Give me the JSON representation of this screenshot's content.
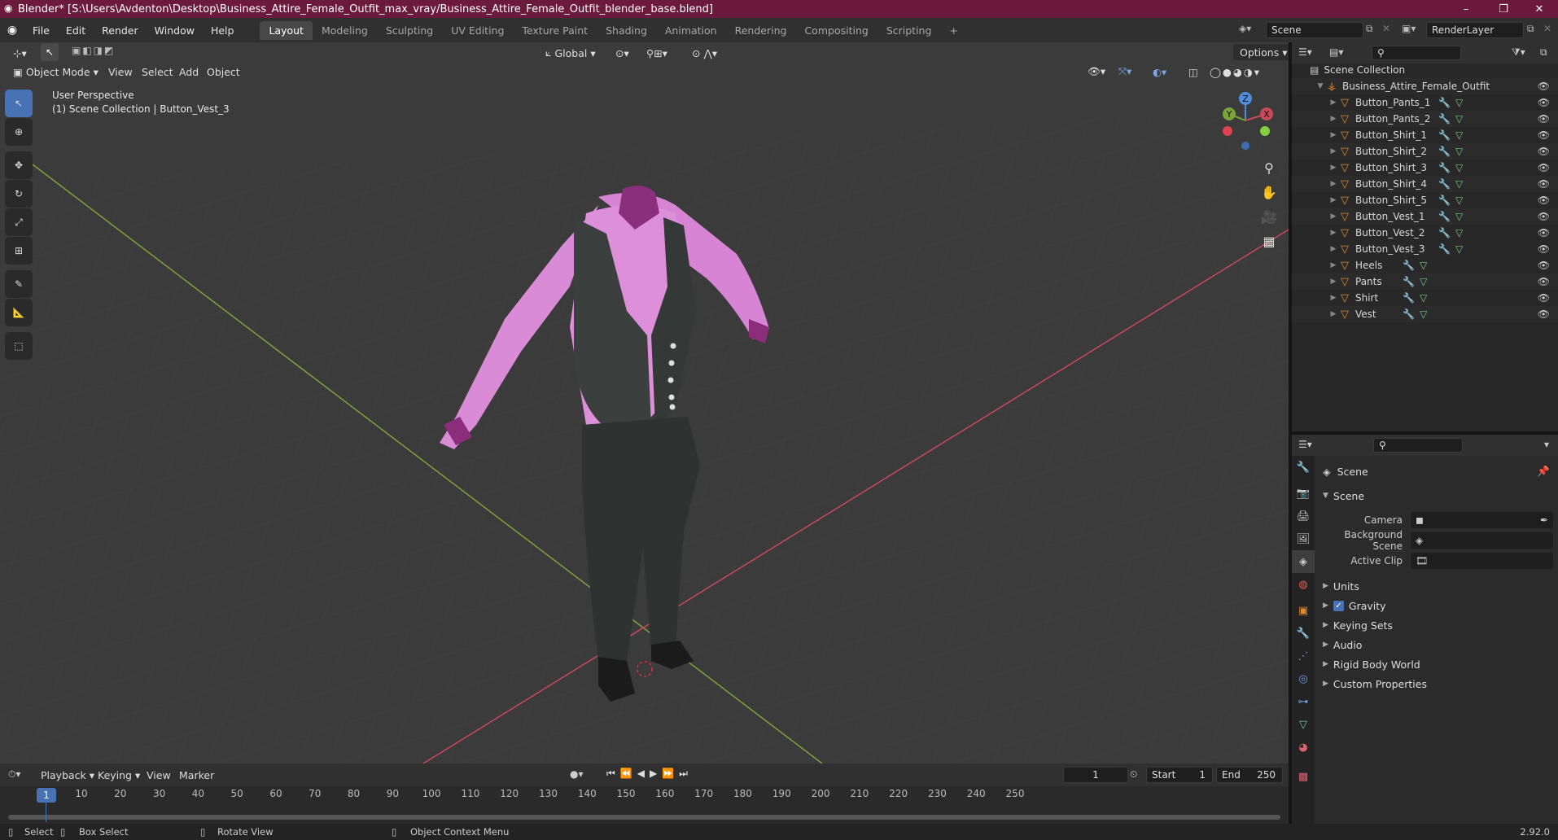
{
  "window": {
    "title": "Blender* [S:\\Users\\Avdenton\\Desktop\\Business_Attire_Female_Outfit_max_vray/Business_Attire_Female_Outfit_blender_base.blend]",
    "minimize": "–",
    "maximize": "❐",
    "close": "✕"
  },
  "menubar": {
    "items": [
      "File",
      "Edit",
      "Render",
      "Window",
      "Help"
    ],
    "workspaces": [
      "Layout",
      "Modeling",
      "Sculpting",
      "UV Editing",
      "Texture Paint",
      "Shading",
      "Animation",
      "Rendering",
      "Compositing",
      "Scripting"
    ],
    "active_workspace": "Layout",
    "add_tab": "+",
    "scene_name": "Scene",
    "render_layer": "RenderLayer"
  },
  "viewport": {
    "mode": "Object Mode",
    "menus": [
      "View",
      "Select",
      "Add",
      "Object"
    ],
    "orientation": "Global",
    "options": "Options",
    "overlay_title": "User Perspective",
    "overlay_sub": "(1) Scene Collection | Button_Vest_3",
    "gizmo": {
      "x": "X",
      "y": "Y",
      "z": "Z"
    }
  },
  "outliner": {
    "root": "Scene Collection",
    "collection": "Business_Attire_Female_Outfit",
    "objects": [
      {
        "name": "Button_Pants_1",
        "selected": false
      },
      {
        "name": "Button_Pants_2",
        "selected": false
      },
      {
        "name": "Button_Shirt_1",
        "selected": false
      },
      {
        "name": "Button_Shirt_2",
        "selected": false
      },
      {
        "name": "Button_Shirt_3",
        "selected": false
      },
      {
        "name": "Button_Shirt_4",
        "selected": false
      },
      {
        "name": "Button_Shirt_5",
        "selected": false
      },
      {
        "name": "Button_Vest_1",
        "selected": false
      },
      {
        "name": "Button_Vest_2",
        "selected": false
      },
      {
        "name": "Button_Vest_3",
        "selected": true
      },
      {
        "name": "Heels",
        "selected": false
      },
      {
        "name": "Pants",
        "selected": false
      },
      {
        "name": "Shirt",
        "selected": false
      },
      {
        "name": "Vest",
        "selected": false
      }
    ]
  },
  "properties": {
    "context": "Scene",
    "panel": "Scene",
    "fields": [
      {
        "label": "Camera",
        "value": ""
      },
      {
        "label": "Background Scene",
        "value": ""
      },
      {
        "label": "Active Clip",
        "value": ""
      }
    ],
    "subpanels": [
      {
        "label": "Units",
        "checkbox": false
      },
      {
        "label": "Gravity",
        "checkbox": true
      },
      {
        "label": "Keying Sets",
        "checkbox": false
      },
      {
        "label": "Audio",
        "checkbox": false
      },
      {
        "label": "Rigid Body World",
        "checkbox": false
      },
      {
        "label": "Custom Properties",
        "checkbox": false
      }
    ]
  },
  "timeline": {
    "menus": [
      "Playback",
      "Keying",
      "View",
      "Marker"
    ],
    "current_frame": "1",
    "start_label": "Start",
    "start": "1",
    "end_label": "End",
    "end": "250",
    "ruler": [
      "1",
      "10",
      "20",
      "30",
      "40",
      "50",
      "60",
      "70",
      "80",
      "90",
      "100",
      "110",
      "120",
      "130",
      "140",
      "150",
      "160",
      "170",
      "180",
      "190",
      "200",
      "210",
      "220",
      "230",
      "240",
      "250"
    ]
  },
  "statusbar": {
    "select": "Select",
    "box_select": "Box Select",
    "rotate_view": "Rotate View",
    "context_menu": "Object Context Menu",
    "version": "2.92.0"
  },
  "colors": {
    "title_bar": "#6b1a3c",
    "accent": "#4772b3",
    "object_icon": "#e08b2e",
    "axis_x": "#c94a56",
    "axis_y": "#7ca33a"
  }
}
